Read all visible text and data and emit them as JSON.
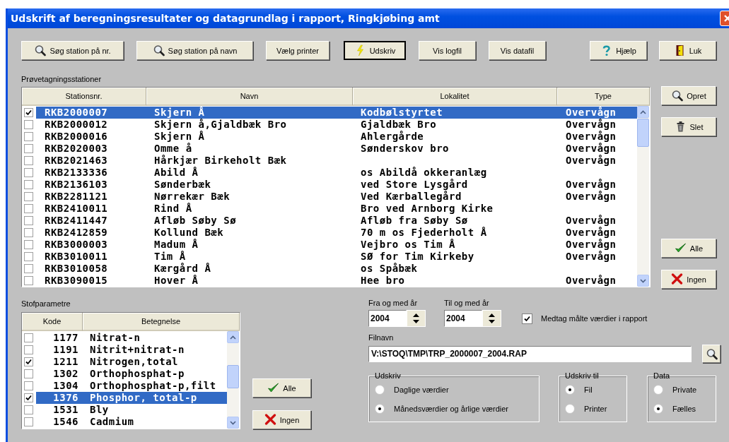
{
  "window": {
    "title": "Udskrift af beregningsresultater og datagrundlag i rapport, Ringkjøbing amt"
  },
  "toolbar": [
    {
      "label": "Søg station på nr.",
      "kind": "search",
      "default": false
    },
    {
      "label": "Søg station på navn",
      "kind": "search",
      "default": false
    },
    {
      "label": "Vælg printer",
      "kind": "plain",
      "default": false
    },
    {
      "label": "Udskriv",
      "kind": "print",
      "default": true
    },
    {
      "label": "Vis logfil",
      "kind": "plain",
      "default": false
    },
    {
      "label": "Vis datafil",
      "kind": "plain",
      "default": false
    },
    {
      "label": "Hjælp",
      "kind": "help",
      "default": false
    },
    {
      "label": "Luk",
      "kind": "close",
      "default": false
    }
  ],
  "stations": {
    "label": "Prøvetagningsstationer",
    "columns": [
      "Stationsnr.",
      "Navn",
      "Lokalitet",
      "Type"
    ],
    "rows": [
      {
        "checked": true,
        "selected": true,
        "station": "RKB2000007",
        "name": "Skjern Å",
        "locality": "Kodbølstyrtet",
        "type": "Overvågn"
      },
      {
        "checked": false,
        "selected": false,
        "station": "RKB2000012",
        "name": "Skjern å,Gjaldbæk Bro",
        "locality": "Gjaldbæk Bro",
        "type": "Overvågn"
      },
      {
        "checked": false,
        "selected": false,
        "station": "RKB2000016",
        "name": "Skjern Å",
        "locality": "Ahlergårde",
        "type": "Overvågn"
      },
      {
        "checked": false,
        "selected": false,
        "station": "RKB2020003",
        "name": "Omme å",
        "locality": "Sønderskov bro",
        "type": "Overvågn"
      },
      {
        "checked": false,
        "selected": false,
        "station": "RKB2021463",
        "name": "Hårkjær Birkeholt Bæk",
        "type": "Overvågn"
      },
      {
        "checked": false,
        "selected": false,
        "station": "RKB2133336",
        "name": "Abild Å",
        "locality": "os Abildå okkeranlæg"
      },
      {
        "checked": false,
        "selected": false,
        "station": "RKB2136103",
        "name": "Sønderbæk",
        "locality": "ved Store Lysgård",
        "type": "Overvågn"
      },
      {
        "checked": false,
        "selected": false,
        "station": "RKB2281121",
        "name": "Nørrekær Bæk",
        "locality": "Ved Kærballegård",
        "type": "Overvågn"
      },
      {
        "checked": false,
        "selected": false,
        "station": "RKB2410011",
        "name": "Rind Å",
        "locality": "Bro ved Arnborg Kirke"
      },
      {
        "checked": false,
        "selected": false,
        "station": "RKB2411447",
        "name": "Afløb Søby Sø",
        "locality": "Afløb fra Søby Sø",
        "type": "Overvågn"
      },
      {
        "checked": false,
        "selected": false,
        "station": "RKB2412859",
        "name": "Kollund Bæk",
        "locality": "70 m os Fjederholt Å",
        "type": "Overvågn"
      },
      {
        "checked": false,
        "selected": false,
        "station": "RKB3000003",
        "name": "Madum Å",
        "locality": "Vejbro os Tim Å",
        "type": "Overvågn"
      },
      {
        "checked": false,
        "selected": false,
        "station": "RKB3010011",
        "name": "Tim Å",
        "locality": "SØ for Tim Kirkeby",
        "type": "Overvågn"
      },
      {
        "checked": false,
        "selected": false,
        "station": "RKB3010058",
        "name": "Kærgård Å",
        "locality": "os Spåbæk"
      },
      {
        "checked": false,
        "selected": false,
        "station": "RKB3090015",
        "name": "Hover Å",
        "locality": "Hee bro",
        "type": "Overvågn"
      }
    ],
    "side_buttons": [
      {
        "label": "Opret",
        "kind": "search"
      },
      {
        "label": "Slet",
        "kind": "delete"
      }
    ],
    "select_buttons": [
      {
        "label": "Alle",
        "kind": "all"
      },
      {
        "label": "Ingen",
        "kind": "none"
      }
    ]
  },
  "parameters": {
    "label": "Stofparametre",
    "columns": [
      "Kode",
      "Betegnelse"
    ],
    "rows": [
      {
        "checked": false,
        "selected": false,
        "code": "1177",
        "name": "Nitrat-n"
      },
      {
        "checked": false,
        "selected": false,
        "code": "1191",
        "name": "Nitrit+nitrat-n"
      },
      {
        "checked": true,
        "selected": false,
        "code": "1211",
        "name": "Nitrogen,total"
      },
      {
        "checked": false,
        "selected": false,
        "code": "1302",
        "name": "Orthophosphat-p"
      },
      {
        "checked": false,
        "selected": false,
        "code": "1304",
        "name": "Orthophosphat-p,filt"
      },
      {
        "checked": true,
        "selected": true,
        "code": "1376",
        "name": "Phosphor, total-p"
      },
      {
        "checked": false,
        "selected": false,
        "code": "1531",
        "name": "Bly"
      },
      {
        "checked": false,
        "selected": false,
        "code": "1546",
        "name": "Cadmium"
      }
    ],
    "select_buttons": [
      {
        "label": "Alle",
        "kind": "all"
      },
      {
        "label": "Ingen",
        "kind": "none"
      }
    ]
  },
  "options": {
    "from_year": {
      "label": "Fra og med år",
      "value": "2004"
    },
    "to_year": {
      "label": "Til og med år",
      "value": "2004"
    },
    "include_measured": {
      "label": "Medtag målte værdier i rapport",
      "checked": true
    },
    "filename": {
      "label": "Filnavn",
      "value": "V:\\STOQ\\TMP\\TRP_2000007_2004.RAP"
    },
    "groups": [
      {
        "title": "Udskriv",
        "options": [
          {
            "label": "Daglige værdier",
            "selected": false
          },
          {
            "label": "Månedsværdier og årlige værdier",
            "selected": true
          }
        ]
      },
      {
        "title": "Udskriv til",
        "options": [
          {
            "label": "Fil",
            "selected": true
          },
          {
            "label": "Printer",
            "selected": false
          }
        ]
      },
      {
        "title": "Data",
        "options": [
          {
            "label": "Private",
            "selected": false
          },
          {
            "label": "Fælles",
            "selected": true
          }
        ]
      }
    ]
  }
}
